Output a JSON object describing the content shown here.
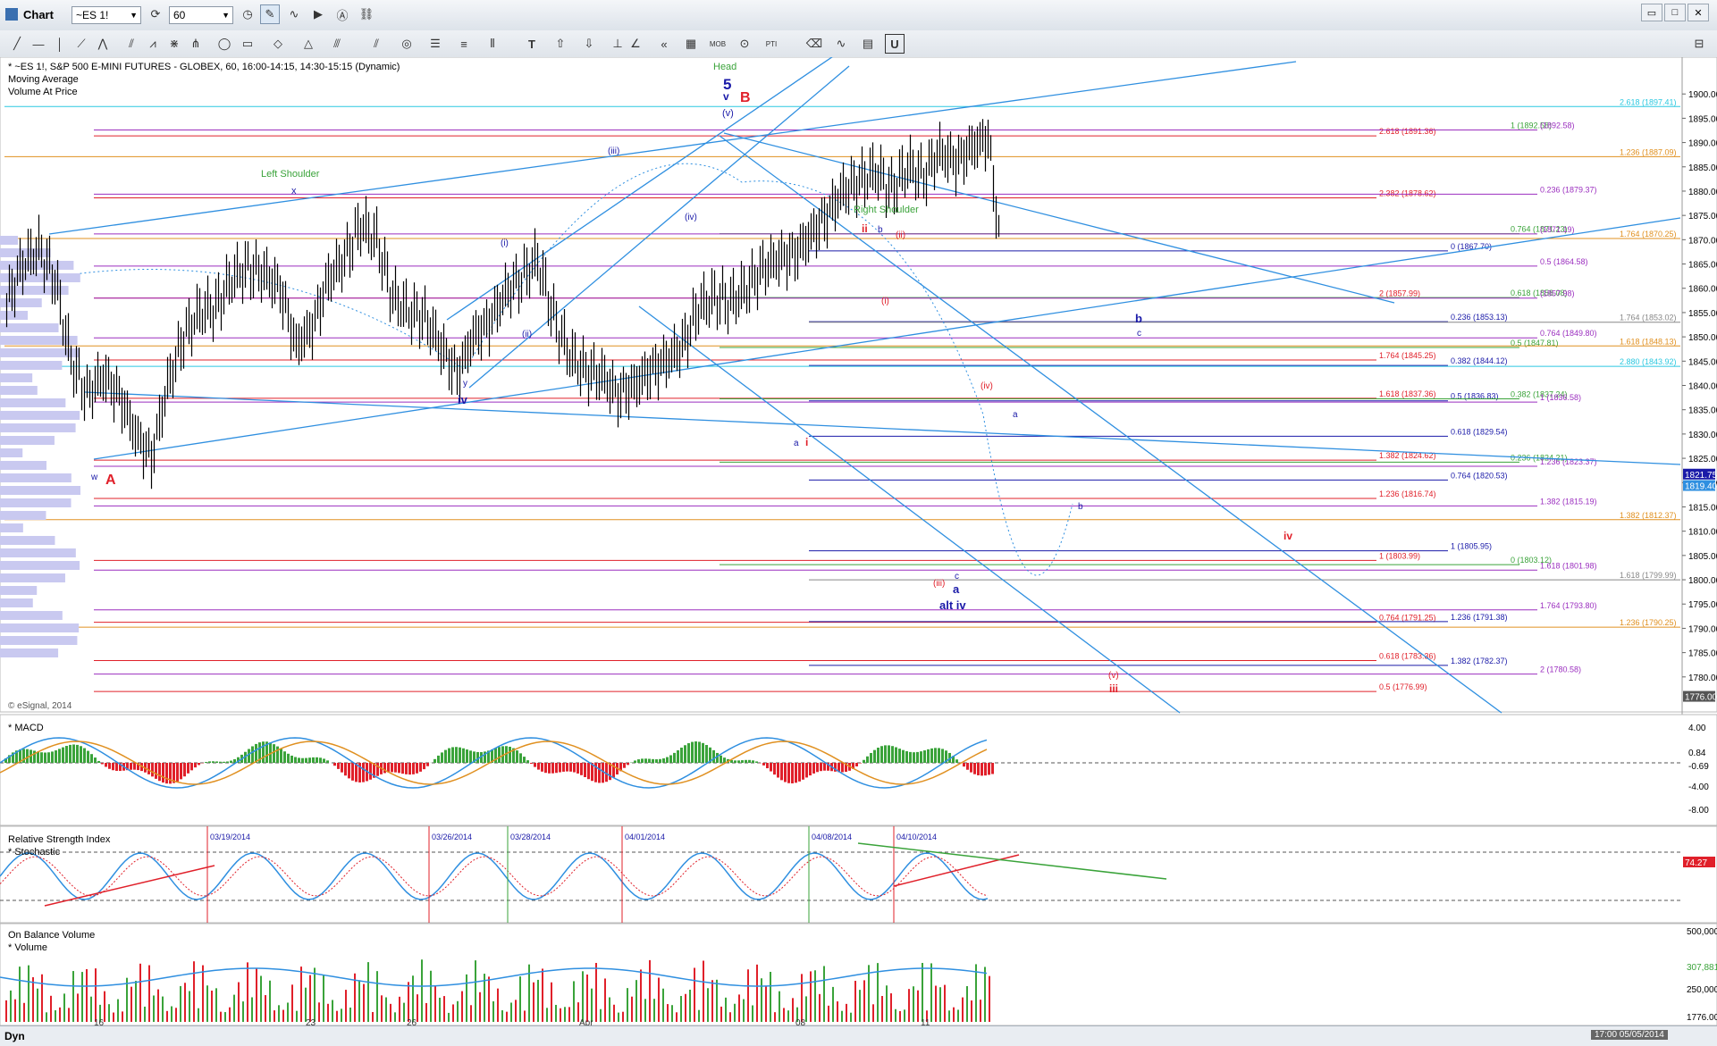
{
  "window": {
    "title": "Chart"
  },
  "toolbar": {
    "symbol": "~ES 1!",
    "interval": "60"
  },
  "header": {
    "line1": "* ~ES 1!, S&P 500 E-MINI FUTURES - GLOBEX, 60, 16:00-14:15, 14:30-15:15 (Dynamic)",
    "line2": "Moving Average",
    "line3": "Volume At Price",
    "copyright": "© eSignal, 2014"
  },
  "panels": {
    "macd": "* MACD",
    "rsi": "Relative Strength Index",
    "stoch": "* Stochastic",
    "obv": "On Balance Volume",
    "vol": "* Volume"
  },
  "status": {
    "dyn": "Dyn",
    "datetime": "17:00 05/05/2014"
  },
  "colors": {
    "bg": "#ffffff",
    "candle": "#000000",
    "trend": "#2f8fe0",
    "red": "#e0202a",
    "green": "#3aa33a",
    "blue": "#1a1aa8",
    "purple": "#9b2fbf",
    "orange": "#e09020",
    "cyan": "#2bc8e0"
  },
  "chart_data": {
    "type": "ohlc",
    "price_axis": {
      "min": 1775,
      "max": 1905,
      "ticks": [
        1900,
        1895,
        1890,
        1885,
        1880,
        1875,
        1870,
        1865,
        1860,
        1855,
        1850,
        1845,
        1840,
        1835,
        1830,
        1825,
        1820,
        1815,
        1810,
        1805,
        1800,
        1795,
        1790,
        1785,
        1780
      ]
    },
    "price_axis_labels": [
      "1900.00",
      "1895.00",
      "1890.00",
      "1885.00",
      "1880.00",
      "1875.00",
      "1870.00",
      "1865.00",
      "1860.00",
      "1855.00",
      "1850.00",
      "1845.00",
      "1840.00",
      "1835.00",
      "1830.00",
      "1825.00",
      "1820.00",
      "1815.00",
      "1810.00",
      "1805.00",
      "1800.00",
      "1795.00",
      "1790.00",
      "1785.00",
      "1780.00"
    ],
    "last_price_badges": [
      {
        "price": 1821.75,
        "label": "1821.75",
        "color": "#1a1aa8"
      },
      {
        "price": 1819.4,
        "label": "1819.40",
        "color": "#2f8fe0"
      },
      {
        "price": 1776,
        "label": "1776.00",
        "color": "#555555"
      }
    ],
    "x_labels": [
      "16",
      "23",
      "26",
      "Apr",
      "08",
      "11"
    ],
    "close_path": [
      [
        0,
        1857
      ],
      [
        6,
        1865
      ],
      [
        12,
        1868
      ],
      [
        18,
        1862
      ],
      [
        24,
        1845
      ],
      [
        30,
        1838
      ],
      [
        36,
        1842
      ],
      [
        42,
        1838
      ],
      [
        48,
        1830
      ],
      [
        54,
        1825
      ],
      [
        60,
        1840
      ],
      [
        66,
        1850
      ],
      [
        72,
        1855
      ],
      [
        78,
        1856
      ],
      [
        84,
        1862
      ],
      [
        90,
        1864
      ],
      [
        96,
        1863
      ],
      [
        102,
        1860
      ],
      [
        108,
        1848
      ],
      [
        114,
        1852
      ],
      [
        120,
        1862
      ],
      [
        126,
        1866
      ],
      [
        132,
        1873
      ],
      [
        138,
        1870
      ],
      [
        144,
        1858
      ],
      [
        150,
        1855
      ],
      [
        156,
        1854
      ],
      [
        162,
        1848
      ],
      [
        168,
        1842
      ],
      [
        174,
        1850
      ],
      [
        180,
        1853
      ],
      [
        186,
        1859
      ],
      [
        192,
        1862
      ],
      [
        198,
        1866
      ],
      [
        204,
        1854
      ],
      [
        210,
        1846
      ],
      [
        216,
        1843
      ],
      [
        222,
        1842
      ],
      [
        228,
        1838
      ],
      [
        234,
        1840
      ],
      [
        240,
        1843
      ],
      [
        246,
        1845
      ],
      [
        252,
        1848
      ],
      [
        258,
        1856
      ],
      [
        264,
        1858
      ],
      [
        270,
        1857
      ],
      [
        276,
        1860
      ],
      [
        282,
        1864
      ],
      [
        288,
        1866
      ],
      [
        294,
        1867
      ],
      [
        300,
        1871
      ],
      [
        306,
        1875
      ],
      [
        312,
        1880
      ],
      [
        318,
        1882
      ],
      [
        324,
        1884
      ],
      [
        330,
        1880
      ],
      [
        336,
        1885
      ],
      [
        342,
        1883
      ],
      [
        348,
        1888
      ],
      [
        354,
        1886
      ],
      [
        360,
        1889
      ],
      [
        366,
        1891
      ],
      [
        372,
        1862
      ],
      [
        378,
        1860
      ],
      [
        384,
        1856
      ],
      [
        390,
        1853
      ],
      [
        396,
        1846
      ],
      [
        402,
        1840
      ],
      [
        408,
        1838
      ],
      [
        414,
        1836
      ],
      [
        420,
        1834
      ],
      [
        426,
        1843
      ],
      [
        432,
        1846
      ],
      [
        438,
        1844
      ],
      [
        444,
        1848
      ],
      [
        450,
        1855
      ],
      [
        456,
        1862
      ],
      [
        462,
        1866
      ],
      [
        468,
        1867
      ],
      [
        474,
        1850
      ],
      [
        480,
        1838
      ],
      [
        486,
        1832
      ],
      [
        492,
        1828
      ],
      [
        498,
        1826
      ],
      [
        504,
        1818
      ],
      [
        510,
        1812
      ],
      [
        516,
        1809
      ],
      [
        522,
        1806
      ],
      [
        528,
        1808
      ],
      [
        534,
        1812
      ],
      [
        540,
        1819
      ],
      [
        546,
        1825
      ],
      [
        552,
        1810
      ]
    ],
    "horizontal_levels": [
      {
        "label": "2.618 (1891.36)",
        "price": 1891.36,
        "color": "#e0202a"
      },
      {
        "label": "2.382 (1878.62)",
        "price": 1878.62,
        "color": "#e0202a"
      },
      {
        "label": "2 (1857.99)",
        "price": 1857.99,
        "color": "#e0202a"
      },
      {
        "label": "1.764 (1845.25)",
        "price": 1845.25,
        "color": "#e0202a"
      },
      {
        "label": "1.618 (1837.36)",
        "price": 1837.36,
        "color": "#e0202a"
      },
      {
        "label": "1.382 (1824.62)",
        "price": 1824.62,
        "color": "#e0202a"
      },
      {
        "label": "1.236 (1816.74)",
        "price": 1816.74,
        "color": "#e0202a"
      },
      {
        "label": "1 (1803.99)",
        "price": 1803.99,
        "color": "#e0202a"
      },
      {
        "label": "0.764 (1791.25)",
        "price": 1791.25,
        "color": "#e0202a"
      },
      {
        "label": "0.618 (1783.36)",
        "price": 1783.36,
        "color": "#e0202a"
      },
      {
        "label": "0.5 (1776.99)",
        "price": 1776.99,
        "color": "#e0202a"
      },
      {
        "label": "0 (1867.70)",
        "price": 1867.7,
        "color": "#1a1aa8"
      },
      {
        "label": "0.236 (1853.13)",
        "price": 1853.13,
        "color": "#1a1aa8"
      },
      {
        "label": "0.382 (1844.12)",
        "price": 1844.12,
        "color": "#1a1aa8"
      },
      {
        "label": "0.5 (1836.83)",
        "price": 1836.83,
        "color": "#1a1aa8"
      },
      {
        "label": "0.618 (1829.54)",
        "price": 1829.54,
        "color": "#1a1aa8"
      },
      {
        "label": "0.764 (1820.53)",
        "price": 1820.53,
        "color": "#1a1aa8"
      },
      {
        "label": "1 (1805.95)",
        "price": 1805.95,
        "color": "#1a1aa8"
      },
      {
        "label": "1.236 (1791.38)",
        "price": 1791.38,
        "color": "#1a1aa8"
      },
      {
        "label": "1.382 (1782.37)",
        "price": 1782.37,
        "color": "#1a1aa8"
      },
      {
        "label": "1 (1892.58)",
        "price": 1892.58,
        "color": "#3aa33a"
      },
      {
        "label": "0.764 (1871.23)",
        "price": 1871.23,
        "color": "#3aa33a"
      },
      {
        "label": "0.618 (1858.08)",
        "price": 1858.08,
        "color": "#3aa33a"
      },
      {
        "label": "0.5 (1847.81)",
        "price": 1847.81,
        "color": "#3aa33a"
      },
      {
        "label": "0.382 (1837.24)",
        "price": 1837.24,
        "color": "#3aa33a"
      },
      {
        "label": "0.236 (1824.21)",
        "price": 1824.21,
        "color": "#3aa33a"
      },
      {
        "label": "0 (1803.12)",
        "price": 1803.12,
        "color": "#3aa33a"
      },
      {
        "label": "(1892.58)",
        "price": 1892.58,
        "color": "#9b2fbf"
      },
      {
        "label": "0.236 (1879.37)",
        "price": 1879.37,
        "color": "#9b2fbf"
      },
      {
        "label": "(1871.19)",
        "price": 1871.19,
        "color": "#9b2fbf"
      },
      {
        "label": "0.5 (1864.58)",
        "price": 1864.58,
        "color": "#9b2fbf"
      },
      {
        "label": "(1857.98)",
        "price": 1857.98,
        "color": "#9b2fbf"
      },
      {
        "label": "0.764 (1849.80)",
        "price": 1849.8,
        "color": "#9b2fbf"
      },
      {
        "label": "1 (1836.58)",
        "price": 1836.58,
        "color": "#9b2fbf"
      },
      {
        "label": "1.236 (1823.37)",
        "price": 1823.37,
        "color": "#9b2fbf"
      },
      {
        "label": "1.382 (1815.19)",
        "price": 1815.19,
        "color": "#9b2fbf"
      },
      {
        "label": "1.618 (1801.98)",
        "price": 1801.98,
        "color": "#9b2fbf"
      },
      {
        "label": "1.764 (1793.80)",
        "price": 1793.8,
        "color": "#9b2fbf"
      },
      {
        "label": "2 (1780.58)",
        "price": 1780.58,
        "color": "#9b2fbf"
      },
      {
        "label": "1.236 (1887.09)",
        "price": 1887.09,
        "color": "#e09020"
      },
      {
        "label": "1.764 (1870.25)",
        "price": 1870.25,
        "color": "#e09020"
      },
      {
        "label": "1.618 (1848.13)",
        "price": 1848.13,
        "color": "#e09020"
      },
      {
        "label": "1.382 (1812.37)",
        "price": 1812.37,
        "color": "#e09020"
      },
      {
        "label": "1.236 (1790.25)",
        "price": 1790.25,
        "color": "#e09020"
      },
      {
        "label": "2.618 (1897.41)",
        "price": 1897.41,
        "color": "#2bc8e0"
      },
      {
        "label": "2.880 (1843.92)",
        "price": 1843.92,
        "color": "#2bc8e0"
      },
      {
        "label": "1.764 (1853.02)",
        "price": 1853.02,
        "color": "#888888"
      },
      {
        "label": "1.618 (1799.99)",
        "price": 1799.99,
        "color": "#888888"
      }
    ],
    "wave_labels": [
      {
        "text": "Head",
        "color": "#3aa33a"
      },
      {
        "text": "5",
        "color": "#1a1aa8"
      },
      {
        "text": "v",
        "color": "#1a1aa8"
      },
      {
        "text": "B",
        "color": "#e0202a"
      },
      {
        "text": "(v)",
        "color": "#1a1aa8"
      },
      {
        "text": "Left Shoulder",
        "color": "#3aa33a"
      },
      {
        "text": "Right Shoulder",
        "color": "#3aa33a"
      },
      {
        "text": "x",
        "color": "#1a1aa8"
      },
      {
        "text": "(iii)",
        "color": "#1a1aa8"
      },
      {
        "text": "(iv)",
        "color": "#1a1aa8"
      },
      {
        "text": "(i)",
        "color": "#1a1aa8"
      },
      {
        "text": "(ii)",
        "color": "#1a1aa8"
      },
      {
        "text": "y",
        "color": "#1a1aa8"
      },
      {
        "text": "iv",
        "color": "#1a1aa8"
      },
      {
        "text": "w",
        "color": "#1a1aa8"
      },
      {
        "text": "A",
        "color": "#e0202a"
      },
      {
        "text": "ii",
        "color": "#e0202a"
      },
      {
        "text": "b",
        "color": "#1a1aa8"
      },
      {
        "text": "(ii)",
        "color": "#e0202a"
      },
      {
        "text": "(i)",
        "color": "#e0202a"
      },
      {
        "text": "a",
        "color": "#1a1aa8"
      },
      {
        "text": "i",
        "color": "#e0202a"
      },
      {
        "text": "(iv)",
        "color": "#e0202a"
      },
      {
        "text": "a",
        "color": "#1a1aa8"
      },
      {
        "text": "b",
        "color": "#1a1aa8"
      },
      {
        "text": "c",
        "color": "#1a1aa8"
      },
      {
        "text": "b",
        "color": "#1a1aa8"
      },
      {
        "text": "iv",
        "color": "#e0202a"
      },
      {
        "text": "(iii)",
        "color": "#e0202a"
      },
      {
        "text": "c",
        "color": "#1a1aa8"
      },
      {
        "text": "a",
        "color": "#1a1aa8"
      },
      {
        "text": "alt iv",
        "color": "#1a1aa8"
      },
      {
        "text": "(v)",
        "color": "#e0202a"
      },
      {
        "text": "iii",
        "color": "#e0202a"
      }
    ],
    "macd_axis_labels": [
      "4.00",
      "0.84",
      "-0.69",
      "-4.00",
      "-8.00"
    ],
    "rsi_axis_labels": [
      "74.27"
    ],
    "rsi_date_labels": [
      "03/19/2014",
      "03/26/2014",
      "03/28/2014",
      "04/01/2014",
      "04/08/2014",
      "04/10/2014"
    ],
    "volume_axis_labels": [
      "500,000",
      "307,881",
      "250,000",
      "1776.00"
    ]
  }
}
